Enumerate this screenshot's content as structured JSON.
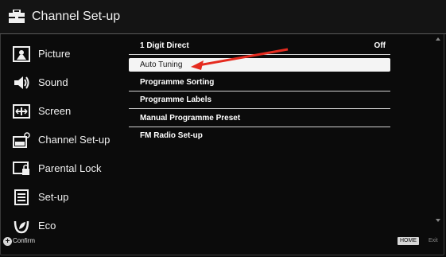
{
  "header": {
    "title": "Channel Set-up",
    "icon": "toolbox-icon"
  },
  "sidebar": {
    "items": [
      {
        "label": "Picture",
        "icon": "picture-icon"
      },
      {
        "label": "Sound",
        "icon": "speaker-icon"
      },
      {
        "label": "Screen",
        "icon": "screen-icon"
      },
      {
        "label": "Channel Set-up",
        "icon": "channel-setup-icon"
      },
      {
        "label": "Parental Lock",
        "icon": "parental-lock-icon"
      },
      {
        "label": "Set-up",
        "icon": "setup-icon"
      },
      {
        "label": "Eco",
        "icon": "eco-icon"
      }
    ]
  },
  "main": {
    "rows": [
      {
        "label": "1 Digit Direct",
        "value": "Off"
      },
      {
        "label": "Auto Tuning",
        "selected": true
      },
      {
        "label": "Programme Sorting"
      },
      {
        "label": "Programme Labels"
      },
      {
        "label": "Manual Programme Preset"
      },
      {
        "label": "FM Radio Set-up"
      }
    ]
  },
  "footer": {
    "confirm_label": "Confirm",
    "home_label": "HOME",
    "exit_label": "Exit"
  },
  "colors": {
    "background": "#0b0b0b",
    "highlight": "#f4f4f4",
    "annotation_arrow": "#e52b1f"
  }
}
